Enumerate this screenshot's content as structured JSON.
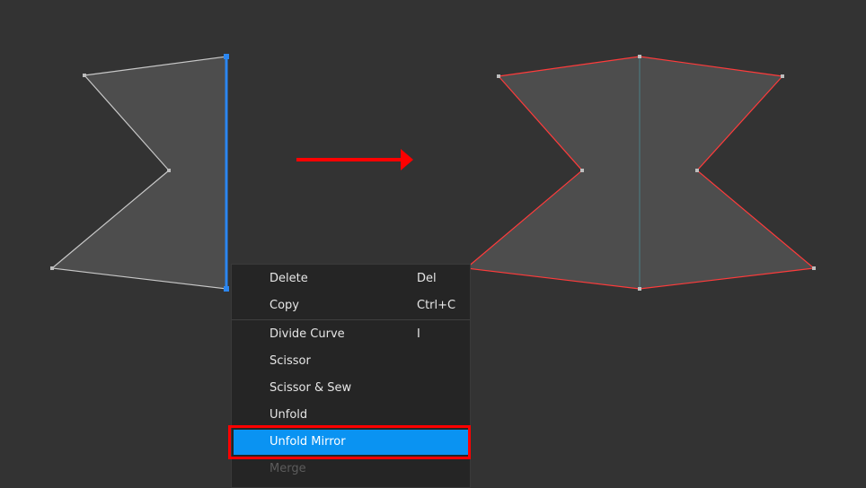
{
  "canvas": {
    "background": "#333333"
  },
  "shapes": {
    "left_piece": {
      "fill": "#4d4d4d",
      "outline_color": "#c8c8c8",
      "selected_edge_color": "#2b86f0",
      "vertex_color": "#bdbdbd",
      "state": "half piece with selected edge"
    },
    "right_piece": {
      "fill": "#4d4d4d",
      "outline_color": "#ff3b3b",
      "mirror_line_color": "#4a7f88",
      "vertex_color": "#bdbdbd",
      "state": "unfolded mirrored piece"
    }
  },
  "annotation_arrow": {
    "color": "#ff0000",
    "icon": "arrow-right-icon"
  },
  "context_menu": {
    "items": [
      {
        "label": "Delete",
        "shortcut": "Del"
      },
      {
        "label": "Copy",
        "shortcut": "Ctrl+C"
      },
      {
        "label": "Divide Curve",
        "shortcut": "I"
      },
      {
        "label": "Scissor",
        "shortcut": ""
      },
      {
        "label": "Scissor & Sew",
        "shortcut": ""
      },
      {
        "label": "Unfold",
        "shortcut": ""
      },
      {
        "label": "Unfold Mirror",
        "shortcut": ""
      },
      {
        "label": "Merge",
        "shortcut": ""
      }
    ],
    "highlighted_item": "Unfold Mirror",
    "disabled_item": "Merge",
    "highlight_color": "#0a93f2",
    "callout_color": "#ff0000"
  }
}
